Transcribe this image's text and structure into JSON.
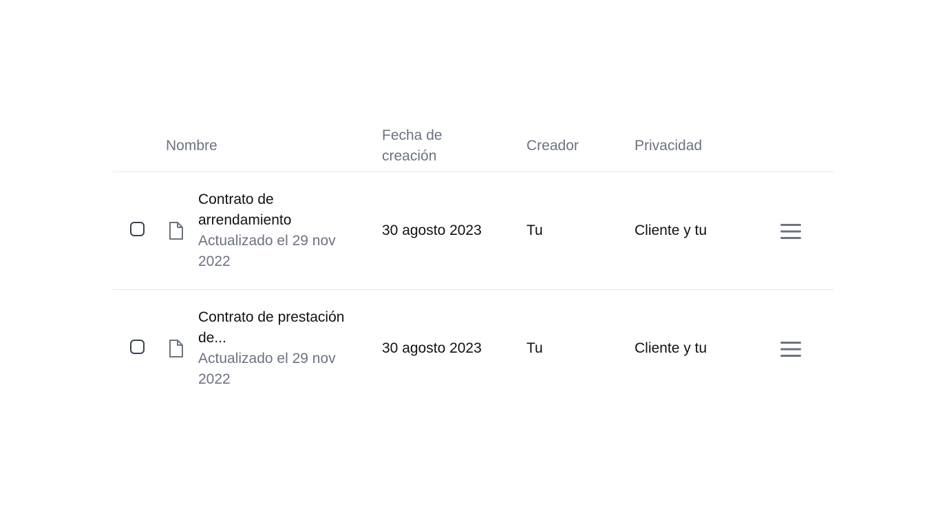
{
  "table": {
    "headers": {
      "name": "Nombre",
      "created": "Fecha de creación",
      "creator": "Creador",
      "privacy": "Privacidad"
    },
    "rows": [
      {
        "title": "Contrato de arrendamiento",
        "subtitle": "Actualizado el 29 nov 2022",
        "created": "30 agosto 2023",
        "creator": "Tu",
        "privacy": "Cliente y tu",
        "icon": "file-icon",
        "menu_icon": "hamburger-menu-icon"
      },
      {
        "title": "Contrato de prestación de...",
        "subtitle": "Actualizado el 29 nov 2022",
        "created": "30 agosto 2023",
        "creator": "Tu",
        "privacy": "Cliente y tu",
        "icon": "file-icon",
        "menu_icon": "hamburger-menu-icon"
      }
    ]
  },
  "colors": {
    "header_text": "#6b7280",
    "body_text": "#111111",
    "divider": "#e5e7eb",
    "icon": "#6b7280"
  }
}
